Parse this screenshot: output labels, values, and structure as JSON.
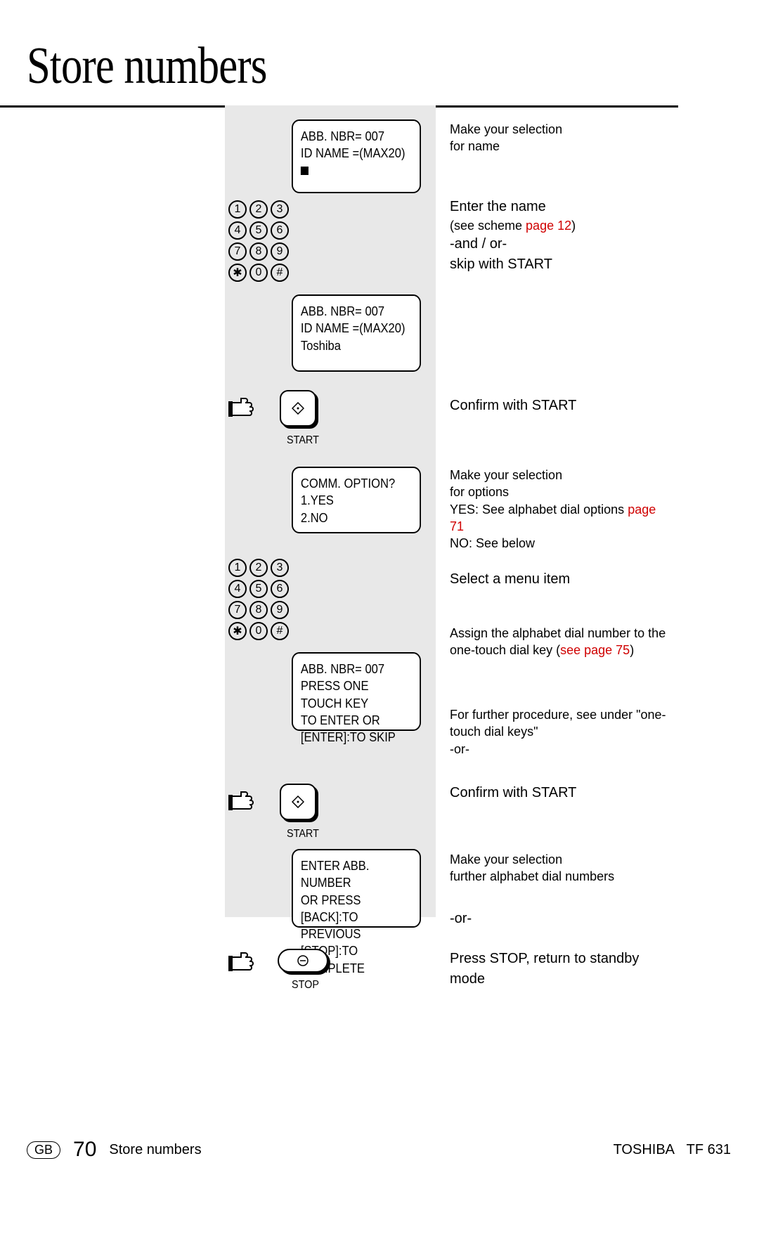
{
  "title": "Store numbers",
  "keypad": [
    "1",
    "2",
    "3",
    "4",
    "5",
    "6",
    "7",
    "8",
    "9",
    "✱",
    "0",
    "#"
  ],
  "displays": {
    "d1": {
      "l1": "ABB. NBR=       007",
      "l2": "",
      "l3": "ID NAME =(MAX20)"
    },
    "d2": {
      "l1": "ABB. NBR=       007",
      "l2": "",
      "l3": "ID NAME =(MAX20)",
      "l4": "Toshiba"
    },
    "d3": {
      "l1": "COMM. OPTION?",
      "l2": "1.YES",
      "l3": "2.NO"
    },
    "d4": {
      "l1": "ABB. NBR=       007",
      "l2": "PRESS ONE TOUCH KEY",
      "l3": "TO ENTER OR",
      "l4": "[ENTER]:TO SKIP"
    },
    "d5": {
      "l1": "ENTER ABB. NUMBER",
      "l2": "OR PRESS",
      "l3": "[BACK]:TO PREVIOUS",
      "l4": "[STOP]:TO COMPLETE"
    }
  },
  "buttons": {
    "start": "START",
    "stop": "STOP"
  },
  "instructions": {
    "i1a": "Make your selection",
    "i1b": "for name",
    "i2a": "Enter the name",
    "i2b_pre": "(see scheme ",
    "i2b_link": "page 12",
    "i2b_post": ")",
    "i2c": "-and / or-",
    "i2d": "skip with START",
    "i3": "Confirm with START",
    "i4a": "Make your selection",
    "i4b": "for options",
    "i4c_pre": "YES: See alphabet dial options ",
    "i4c_link": "page 71",
    "i4d": "NO: See below",
    "i5": "Select a menu item",
    "i6a": "Assign the alphabet dial number to the one-touch dial key (",
    "i6a_link": "see page 75",
    "i6a_post": ")",
    "i7a": "For further procedure, see under \"one-touch dial keys\"",
    "i7b": "-or-",
    "i8": "Confirm with START",
    "i9a": "Make your selection",
    "i9b": "further alphabet dial numbers",
    "i10": "-or-",
    "i11": "Press STOP, return to standby mode"
  },
  "footer": {
    "region": "GB",
    "page": "70",
    "section": "Store numbers",
    "brand": "TOSHIBA",
    "model": "TF 631"
  }
}
